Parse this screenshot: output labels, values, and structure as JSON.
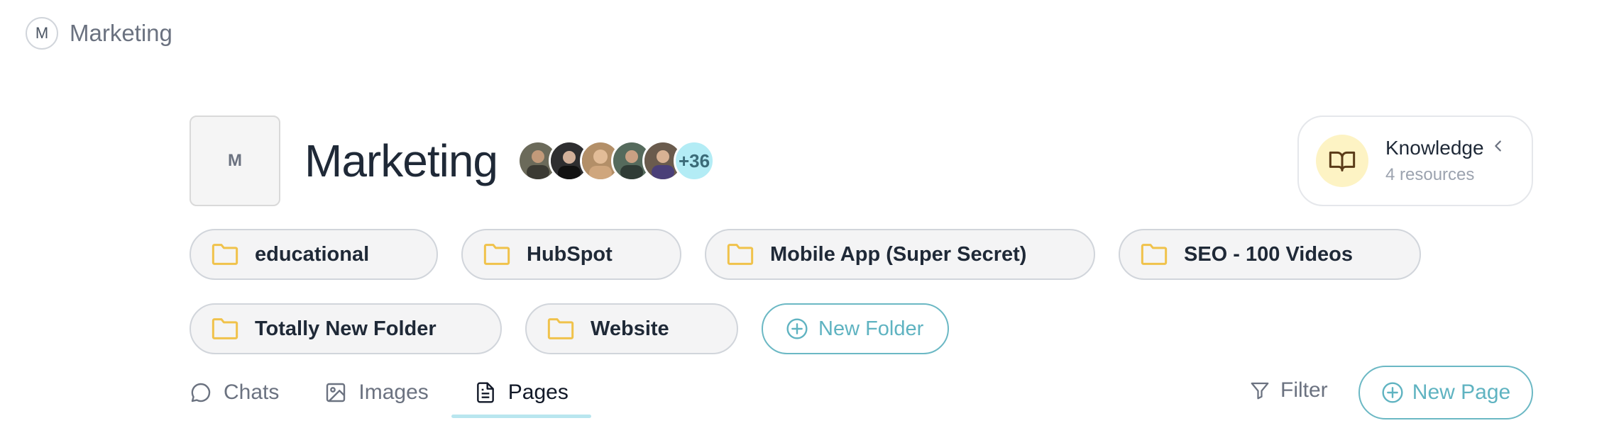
{
  "topbar": {
    "avatar_letter": "M",
    "workspace_name": "Marketing"
  },
  "space": {
    "icon_letter": "M",
    "title": "Marketing",
    "members": [
      {
        "avatar_color": "#6b6a5a"
      },
      {
        "avatar_color": "#2e2e30"
      },
      {
        "avatar_color": "#b38f68"
      },
      {
        "avatar_color": "#556a5c"
      },
      {
        "avatar_color": "#6a5b4d"
      }
    ],
    "more_members": "+36"
  },
  "knowledge": {
    "title": "Knowledge",
    "subtitle": "4 resources",
    "accent": "#fdf3c4"
  },
  "folders": {
    "row1": [
      {
        "name": "educational"
      },
      {
        "name": "HubSpot"
      },
      {
        "name": "Mobile App (Super Secret)"
      },
      {
        "name": "SEO - 100 Videos"
      }
    ],
    "row2": [
      {
        "name": "Totally New Folder"
      },
      {
        "name": "Website"
      }
    ],
    "new_folder_label": "New Folder",
    "folder_color": "#f0c24b"
  },
  "tabs": [
    {
      "label": "Chats",
      "icon": "chat-bubble-icon",
      "active": false
    },
    {
      "label": "Images",
      "icon": "image-icon",
      "active": false
    },
    {
      "label": "Pages",
      "icon": "document-icon",
      "active": true
    }
  ],
  "actions": {
    "filter_label": "Filter",
    "new_page_label": "New Page"
  },
  "colors": {
    "accent_teal": "#5fb3c1",
    "text_dark": "#1f2937",
    "text_muted": "#6b7280"
  }
}
